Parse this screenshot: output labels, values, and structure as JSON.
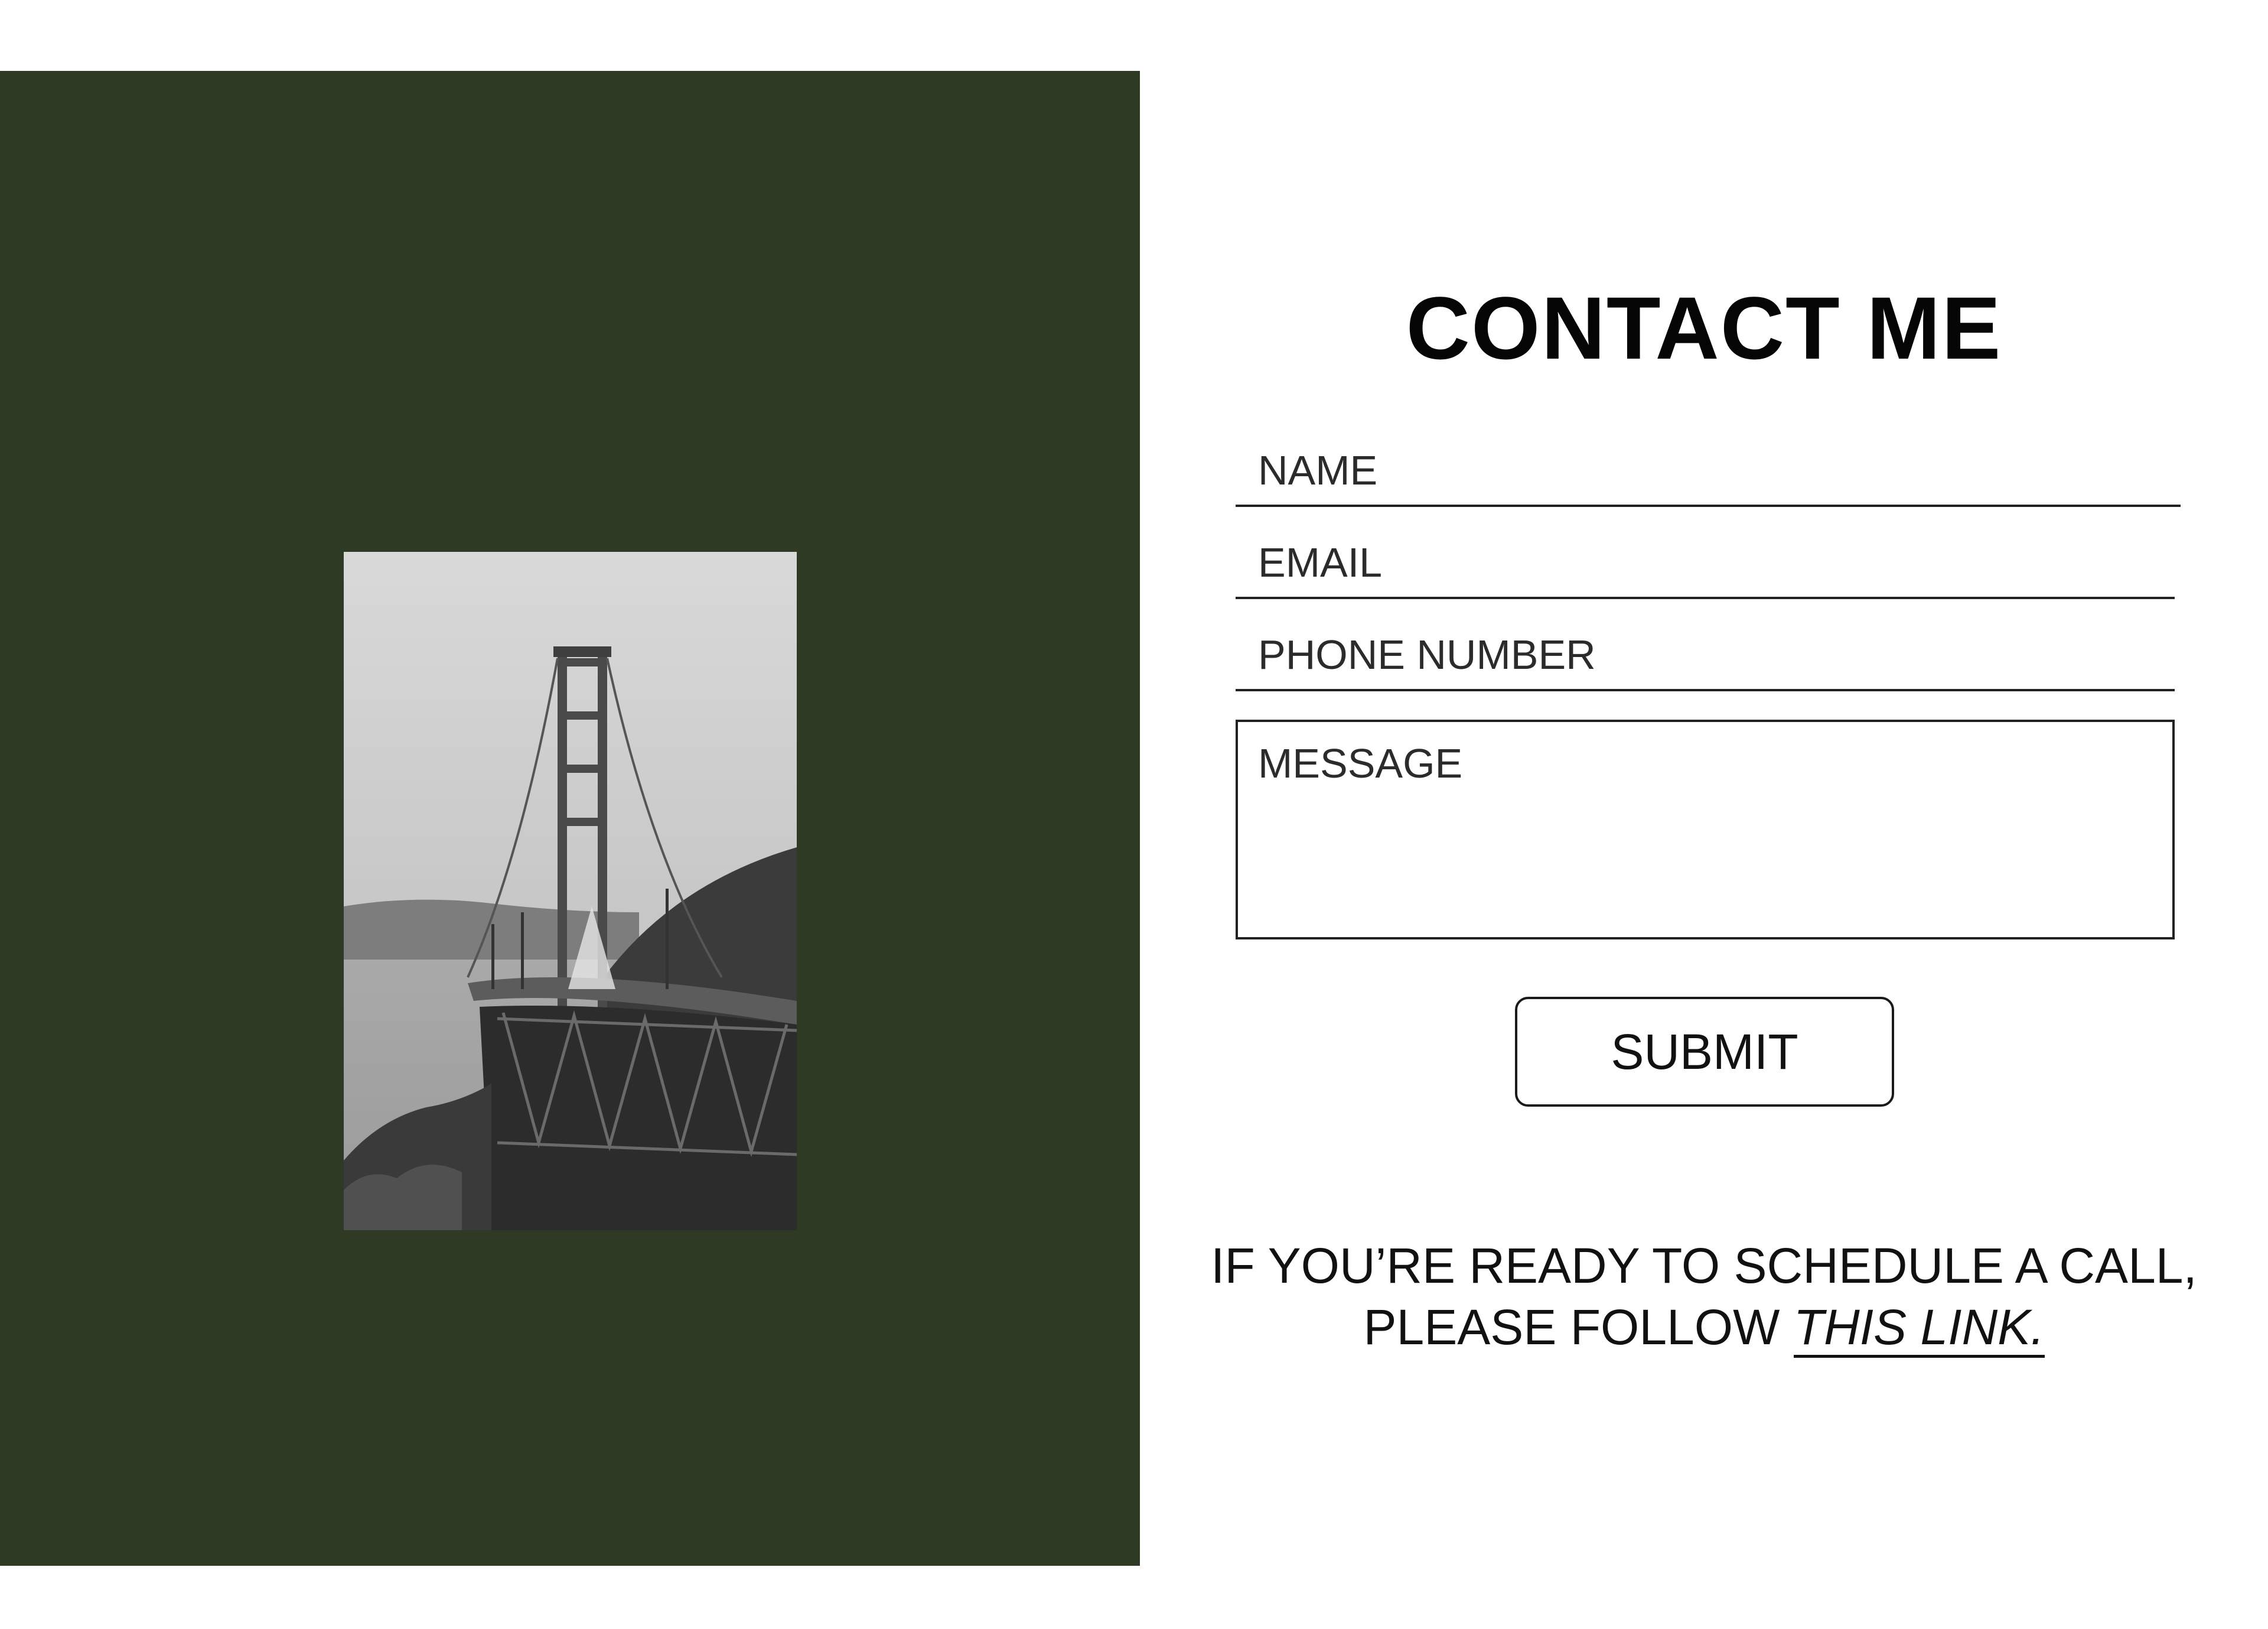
{
  "contact": {
    "title": "CONTACT ME",
    "fields": {
      "name_placeholder": "NAME",
      "email_placeholder": "EMAIL",
      "phone_placeholder": "PHONE NUMBER",
      "message_placeholder": "MESSAGE"
    },
    "submit_label": "SUBMIT",
    "cta": {
      "line1": "IF YOU’RE READY TO SCHEDULE A CALL,",
      "line2_prefix": "PLEASE FOLLOW ",
      "link_text": "THIS LINK",
      "line2_suffix": "."
    }
  },
  "colors": {
    "panel_background": "#2f3a24",
    "page_background": "#ffffff",
    "text": "#111111"
  }
}
